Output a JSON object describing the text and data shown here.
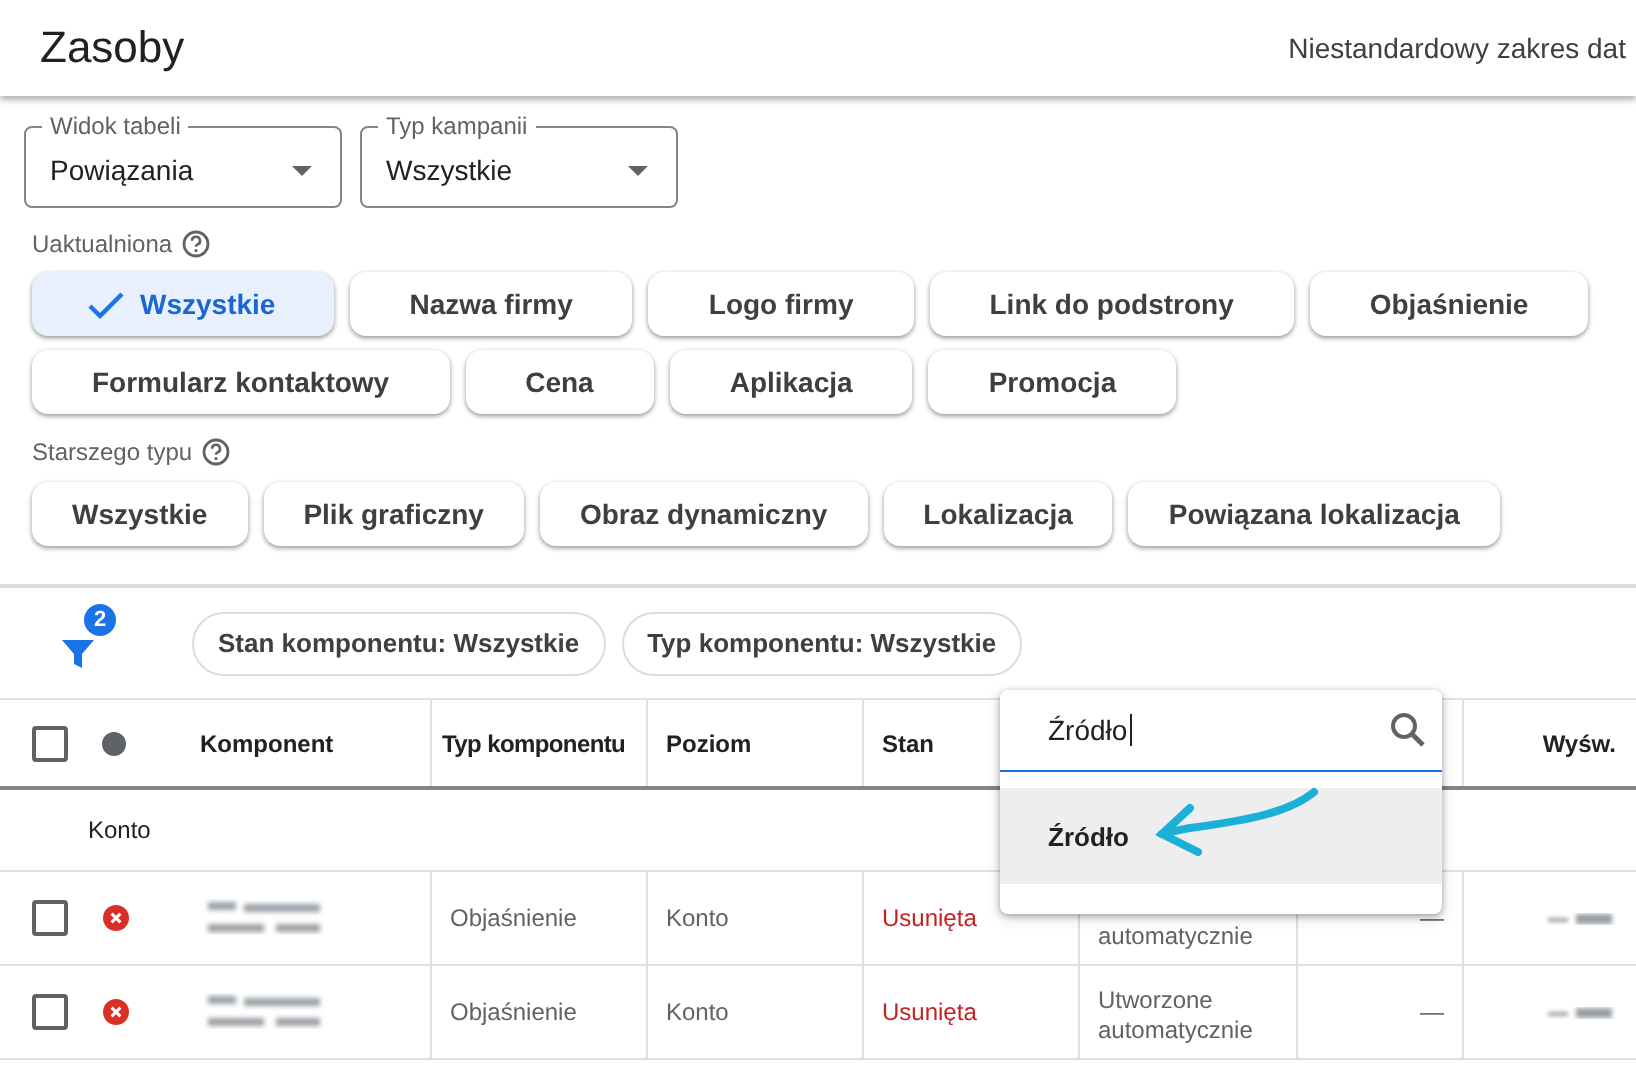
{
  "header": {
    "title": "Zasoby",
    "date_range": "Niestandardowy zakres dat"
  },
  "dropdowns": [
    {
      "label": "Widok tabeli",
      "value": "Powiązania"
    },
    {
      "label": "Typ kampanii",
      "value": "Wszystkie"
    }
  ],
  "chip_groups": [
    {
      "label": "Uaktualniona",
      "chips": [
        {
          "label": "Wszystkie",
          "selected": true
        },
        {
          "label": "Nazwa firmy",
          "selected": false
        },
        {
          "label": "Logo firmy",
          "selected": false
        },
        {
          "label": "Link do podstrony",
          "selected": false
        },
        {
          "label": "Objaśnienie",
          "selected": false
        },
        {
          "label": "Formularz kontaktowy",
          "selected": false
        },
        {
          "label": "Cena",
          "selected": false
        },
        {
          "label": "Aplikacja",
          "selected": false
        },
        {
          "label": "Promocja",
          "selected": false
        }
      ]
    },
    {
      "label": "Starszego typu",
      "chips": [
        {
          "label": "Wszystkie",
          "selected": false
        },
        {
          "label": "Plik graficzny",
          "selected": false
        },
        {
          "label": "Obraz dynamiczny",
          "selected": false
        },
        {
          "label": "Lokalizacja",
          "selected": false
        },
        {
          "label": "Powiązana lokalizacja",
          "selected": false
        }
      ]
    }
  ],
  "filters": {
    "count": "2",
    "chips": [
      "Stan komponentu: Wszystkie",
      "Typ komponentu: Wszystkie"
    ]
  },
  "table": {
    "select_all_checked": false,
    "columns": [
      {
        "label": "Komponent"
      },
      {
        "label": "Typ komponentu"
      },
      {
        "label": "Poziom"
      },
      {
        "label": "Stan"
      },
      {
        "label": "Wyśw."
      }
    ],
    "group": "Konto",
    "rows": [
      {
        "checked": false,
        "kind": "error",
        "type": "Objaśnienie",
        "level": "Konto",
        "state": "Usunięta",
        "source": "automatycznie",
        "column_7": "—"
      },
      {
        "checked": false,
        "kind": "error",
        "type": "Objaśnienie",
        "level": "Konto",
        "state": "Usunięta",
        "source": "Utworzone automatycznie",
        "column_7": "—"
      }
    ]
  },
  "column_picker": {
    "query": "Źródło",
    "options": [
      {
        "label": "Źródło",
        "selected": true
      }
    ]
  }
}
